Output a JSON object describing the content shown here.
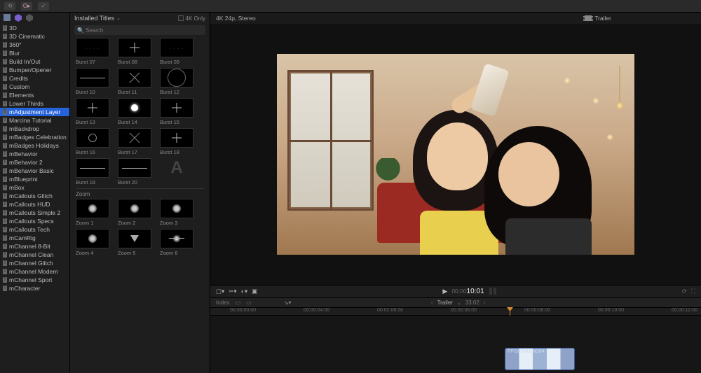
{
  "topbar": {
    "btn1": "⟲",
    "btn2": "O▸",
    "btn3": "✓"
  },
  "categories": {
    "dropdown_label": "Installed Titles",
    "items": [
      "3D",
      "3D Cinematic",
      "360°",
      "Blur",
      "Build In/Out",
      "Bumper/Opener",
      "Credits",
      "Custom",
      "Elements",
      "Lower Thirds",
      "mAdjustment Layer",
      "Marcina Tutorial",
      "mBackdrop",
      "mBadges Celebration",
      "mBadges Holidays",
      "mBehavior",
      "mBehavior 2",
      "mBehavior Basic",
      "mBlueprint",
      "mBox",
      "mCallouts Glitch",
      "mCallouts HUD",
      "mCallouts Simple 2",
      "mCallouts Specs",
      "mCallouts Tech",
      "mCamRig",
      "mChannel 8-Bit",
      "mChannel Clean",
      "mChannel Glitch",
      "mChannel Modern",
      "mChannel Sport",
      "mCharacter"
    ],
    "selected_index": 10
  },
  "browser": {
    "only4k_label": "4K Only",
    "search_placeholder": "Search",
    "section_zoom": "Zoom",
    "thumbs": [
      {
        "label": "Burst 07",
        "v": "dots"
      },
      {
        "label": "Burst 08",
        "v": "star"
      },
      {
        "label": "Burst 09",
        "v": "dots"
      },
      {
        "label": "Burst 10",
        "v": "hline"
      },
      {
        "label": "Burst 11",
        "v": "xcross"
      },
      {
        "label": "Burst 12",
        "v": "ringbig"
      },
      {
        "label": "Burst 13",
        "v": "star"
      },
      {
        "label": "Burst 14",
        "v": "sun"
      },
      {
        "label": "Burst 15",
        "v": "star"
      },
      {
        "label": "Burst 16",
        "v": "ring"
      },
      {
        "label": "Burst 17",
        "v": "xcross"
      },
      {
        "label": "Burst 18",
        "v": "star"
      },
      {
        "label": "Burst 19",
        "v": "hline"
      },
      {
        "label": "Burst 20",
        "v": "hline"
      },
      {
        "label": "",
        "v": "A"
      }
    ],
    "zoom_thumbs": [
      {
        "label": "Zoom 1",
        "v": "blob"
      },
      {
        "label": "Zoom 2",
        "v": "blob"
      },
      {
        "label": "Zoom 3",
        "v": "blob"
      },
      {
        "label": "Zoom 4",
        "v": "blob"
      },
      {
        "label": "Zoom 5",
        "v": "vshape"
      },
      {
        "label": "Zoom 6",
        "v": "flare"
      }
    ]
  },
  "viewer": {
    "format": "4K 24p, Stereo",
    "project_label": "Trailer",
    "timecode_prefix": "00:00",
    "timecode": "10:01"
  },
  "timeline": {
    "index_label": "Index",
    "project_label": "Trailer",
    "duration": "33:02",
    "ruler": [
      "00:00:00:00",
      "00:00:04:00",
      "00:02:08:00",
      "00:00:06:00",
      "00:00:08:00",
      "00:00:10:00",
      "00:00:12:00"
    ],
    "clip_name": "FPG00042mD04"
  }
}
